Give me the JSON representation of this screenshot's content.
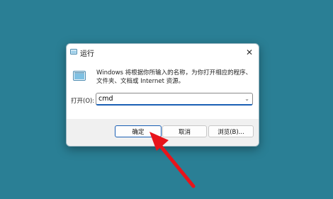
{
  "dialog": {
    "title": "运行",
    "close_glyph": "✕",
    "description": "Windows 将根据你所输入的名称，为你打开相应的程序、文件夹、文档或 Internet 资源。",
    "open_label": "打开(O):",
    "open_value": "cmd",
    "dropdown_glyph": "⌄",
    "buttons": {
      "ok": "确定",
      "cancel": "取消",
      "browse": "浏览(B)..."
    }
  },
  "colors": {
    "desktop": "#2a7f95",
    "accent": "#1a5fb4",
    "arrow": "#e8141b"
  },
  "icons": [
    "run-app-icon",
    "close-icon",
    "chevron-down-icon",
    "red-arrow-icon"
  ]
}
